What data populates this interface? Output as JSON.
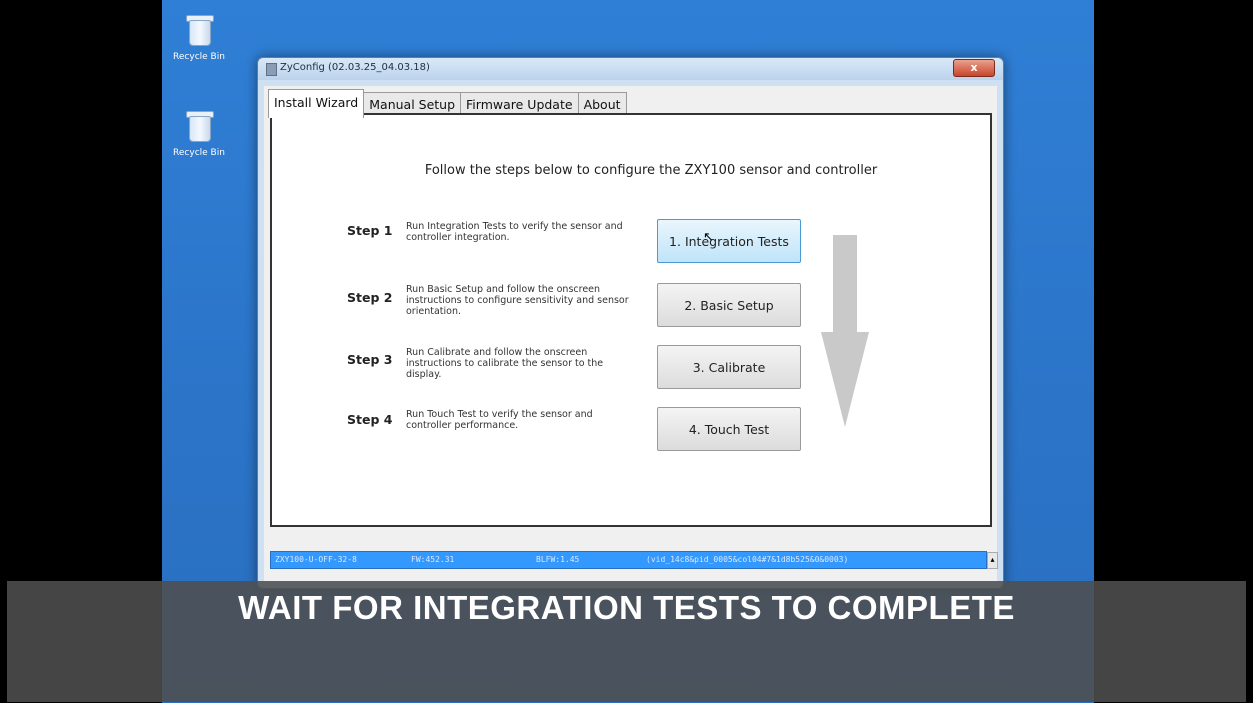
{
  "desktop": {
    "icons": [
      {
        "label": "Recycle Bin"
      },
      {
        "label": "Recycle Bin"
      }
    ]
  },
  "window": {
    "title": "ZyConfig (02.03.25_04.03.18)",
    "close_label": "x",
    "tabs": [
      {
        "label": "Install Wizard",
        "active": true
      },
      {
        "label": "Manual Setup",
        "active": false
      },
      {
        "label": "Firmware Update",
        "active": false
      },
      {
        "label": "About",
        "active": false
      }
    ],
    "instruction": "Follow the steps below to configure the ZXY100 sensor and controller",
    "steps": [
      {
        "label": "Step 1",
        "description": "Run Integration Tests to verify the sensor and controller integration.",
        "button": "1. Integration Tests"
      },
      {
        "label": "Step 2",
        "description": "Run Basic Setup and follow the onscreen instructions to configure sensitivity and sensor orientation.",
        "button": "2. Basic Setup"
      },
      {
        "label": "Step 3",
        "description": "Run Calibrate and follow the onscreen instructions to calibrate the sensor to the display.",
        "button": "3. Calibrate"
      },
      {
        "label": "Step 4",
        "description": "Run Touch Test to verify the sensor and controller performance.",
        "button": "4. Touch Test"
      }
    ],
    "status": {
      "device": "ZXY100-U-OFF-32-8",
      "fw": "FW:452.31",
      "blfw": "BLFW:1.45",
      "vid": "(vid_14c8&pid_0005&col04#7&1d8b525&0&0003)"
    }
  },
  "caption": "WAIT FOR INTEGRATION TESTS TO COMPLETE",
  "colors": {
    "desktop": "#2b74c8",
    "status_bar": "#3399ff",
    "button_hover": "#bfe4f9",
    "arrow": "#c9c9c9"
  }
}
